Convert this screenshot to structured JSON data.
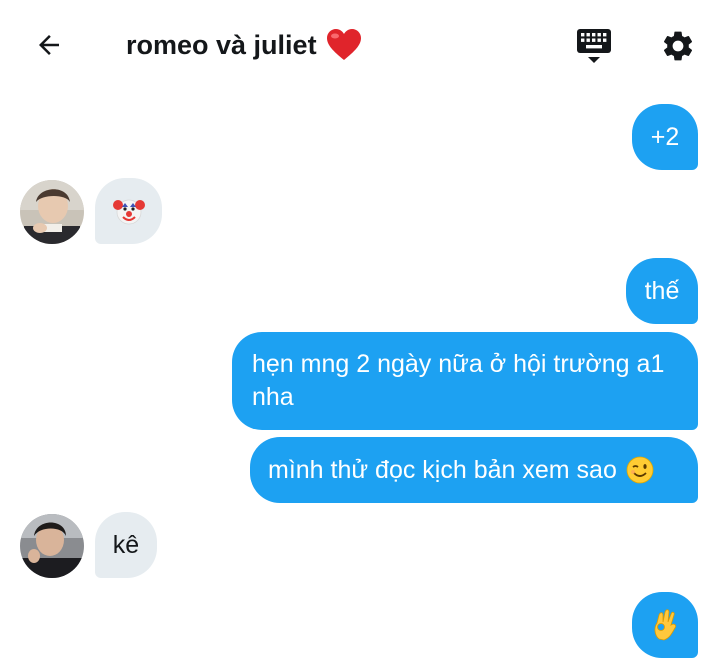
{
  "header": {
    "back_icon": "arrow-left-icon",
    "title": "romeo và juliet",
    "title_emoji": "heart-emoji",
    "keyboard_icon": "keyboard-icon",
    "settings_icon": "gear-icon"
  },
  "messages": [
    {
      "direction": "outgoing",
      "text": "+2"
    },
    {
      "direction": "incoming",
      "text": "",
      "emoji": "clown-face-emoji"
    },
    {
      "direction": "outgoing",
      "text": "thế"
    },
    {
      "direction": "outgoing",
      "text": "hẹn mng 2 ngày nữa ở hội trường a1 nha"
    },
    {
      "direction": "outgoing",
      "text": "mình thử đọc kịch bản xem sao",
      "emoji": "winking-face-emoji"
    },
    {
      "direction": "incoming",
      "text": "kê"
    },
    {
      "direction": "outgoing",
      "text": "",
      "emoji": "ok-hand-emoji"
    }
  ],
  "colors": {
    "outgoing_bubble": "#1da1f2",
    "incoming_bubble": "#e6ecf0",
    "text_dark": "#14171a"
  }
}
